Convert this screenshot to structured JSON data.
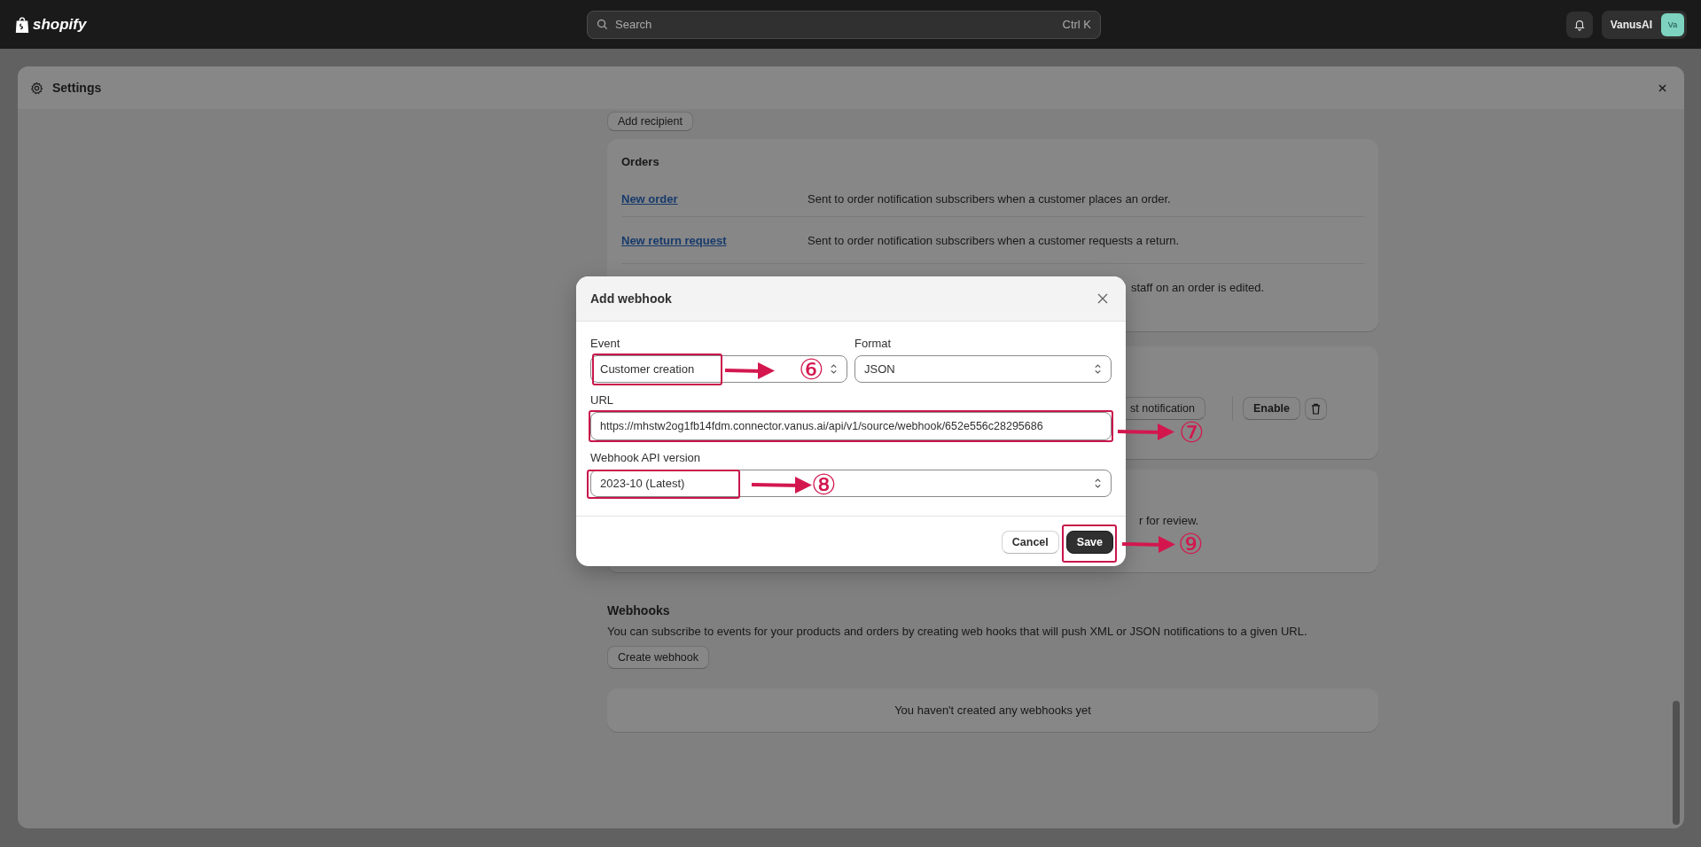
{
  "topbar": {
    "logo": "shopify",
    "search": {
      "placeholder": "Search",
      "shortcut": "Ctrl K"
    },
    "account": {
      "name": "VanusAI",
      "initials": "Va"
    }
  },
  "settings": {
    "title": "Settings",
    "add_recipient": "Add recipient",
    "orders": {
      "title": "Orders",
      "rows": [
        {
          "kind": "link",
          "link": "New order",
          "description": "Sent to order notification subscribers when a customer places an order."
        },
        {
          "kind": "link",
          "link": "New return request",
          "description": "Sent to order notification subscribers when a customer requests a return."
        },
        {
          "kind": "partial",
          "description": "staff on an order is edited."
        }
      ]
    },
    "card_2": {
      "button_1": "st notification",
      "button_2": "Enable"
    },
    "card_3": {
      "text": "r for review."
    },
    "webhooks": {
      "title": "Webhooks",
      "description": "You can subscribe to events for your products and orders by creating web hooks that will push XML or JSON notifications to a given URL.",
      "create_button": "Create webhook",
      "empty_text": "You haven't created any webhooks yet"
    }
  },
  "modal": {
    "title": "Add webhook",
    "event": {
      "label": "Event",
      "value": "Customer creation"
    },
    "format": {
      "label": "Format",
      "value": "JSON"
    },
    "url": {
      "label": "URL",
      "value": "https://mhstw2og1fb14fdm.connector.vanus.ai/api/v1/source/webhook/652e556c28295686"
    },
    "api_version": {
      "label": "Webhook API version",
      "value": "2023-10 (Latest)"
    },
    "cancel": "Cancel",
    "save": "Save"
  },
  "annotations": [
    {
      "number": "⑥"
    },
    {
      "number": "⑦"
    },
    {
      "number": "⑧"
    },
    {
      "number": "⑨"
    }
  ]
}
